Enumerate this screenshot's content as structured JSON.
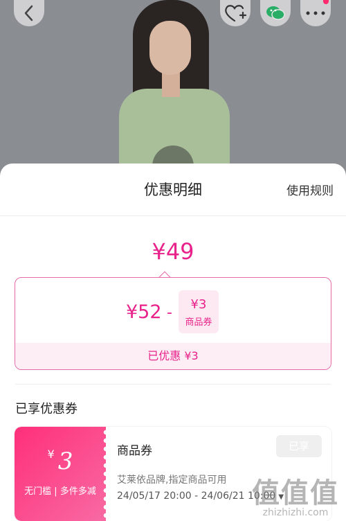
{
  "sheet": {
    "title": "优惠明细",
    "rules_link": "使用规则"
  },
  "price": {
    "final": "¥49",
    "original": "¥52",
    "minus": "-",
    "coupon_amount": "¥3",
    "coupon_label": "商品券",
    "saved": "已优惠 ¥3"
  },
  "section": {
    "title": "已享优惠券"
  },
  "coupon": {
    "currency": "¥",
    "amount": "3",
    "condition": "无门槛 | 多件多减",
    "name": "商品券",
    "description": "艾莱依品牌,指定商品可用",
    "validity": "24/05/17 20:00 - 24/06/21 10:00",
    "status_button": "已享"
  },
  "watermark": {
    "logo": "值",
    "site": "zhizhizhi.com"
  },
  "colors": {
    "accent": "#e8228a",
    "coupon_gradient_start": "#ff2f7a",
    "coupon_gradient_end": "#f86aa3"
  },
  "icons": {
    "back": "chevron-left-icon",
    "favorite": "heart-plus-icon",
    "share": "wechat-icon",
    "more": "more-dots-icon",
    "expand": "caret-down-icon"
  }
}
